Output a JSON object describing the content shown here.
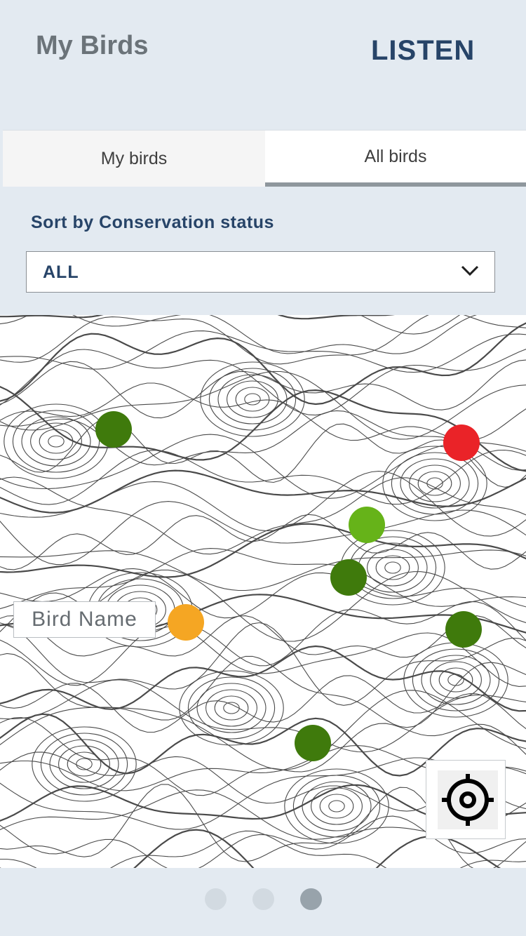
{
  "header": {
    "title": "My Birds",
    "listen_label": "LISTEN"
  },
  "tabs": [
    {
      "label": "My birds",
      "active": false
    },
    {
      "label": "All birds",
      "active": true
    }
  ],
  "sort": {
    "label": "Sort by Conservation status",
    "selected": "ALL"
  },
  "map": {
    "bird_label": "Bird Name",
    "markers": [
      {
        "name": "marker-dark-green",
        "color": "#3f7a0c"
      },
      {
        "name": "marker-red",
        "color": "#ea2328"
      },
      {
        "name": "marker-light-green",
        "color": "#66b319"
      },
      {
        "name": "marker-dark-green",
        "color": "#3f7a0c"
      },
      {
        "name": "marker-orange",
        "color": "#f5a623"
      },
      {
        "name": "marker-dark-green",
        "color": "#3f7a0c"
      },
      {
        "name": "marker-dark-green",
        "color": "#3f7a0c"
      }
    ],
    "locate_icon": "crosshair-icon"
  },
  "pager": {
    "count": 3,
    "active_index": 2,
    "active_color": "#98a3ab",
    "inactive_color": "#d2dae1"
  },
  "colors": {
    "background": "#e3eaf1",
    "accent": "#274468"
  }
}
